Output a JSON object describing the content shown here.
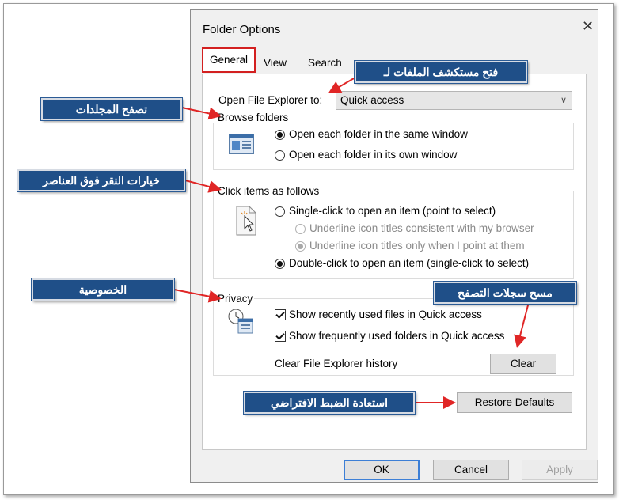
{
  "dialog": {
    "title": "Folder Options",
    "close": "✕",
    "tabs": [
      "General",
      "View",
      "Search"
    ]
  },
  "general": {
    "open_explorer_label": "Open File Explorer to:",
    "open_explorer_value": "Quick access",
    "browse": {
      "title": "Browse folders",
      "options": [
        "Open each folder in the same window",
        "Open each folder in its own window"
      ]
    },
    "click": {
      "title": "Click items as follows",
      "single": "Single-click to open an item (point to select)",
      "underline_browser": "Underline icon titles consistent with my browser",
      "underline_point": "Underline icon titles only when I point at them",
      "double": "Double-click to open an item (single-click to select)"
    },
    "privacy": {
      "title": "Privacy",
      "recent_files": "Show recently used files in Quick access",
      "frequent_folders": "Show frequently used folders in Quick access",
      "clear_label": "Clear File Explorer history",
      "clear_button": "Clear"
    },
    "restore_button": "Restore Defaults"
  },
  "footer": {
    "ok": "OK",
    "cancel": "Cancel",
    "apply": "Apply"
  },
  "callouts": {
    "open_explorer": "فتح مستكشف الملفات لـ",
    "browse": "تصفح المجلدات",
    "click": "خيارات النقر فوق العناصر",
    "privacy": "الخصوصية",
    "clear_history": "مسح سجلات التصفح",
    "restore": "استعادة الضبط الافتراضي"
  },
  "colors": {
    "callout_bg": "#1f4f88",
    "arrow": "#e02626",
    "tab_highlight": "#d32020",
    "default_button": "#3c7fd6"
  }
}
